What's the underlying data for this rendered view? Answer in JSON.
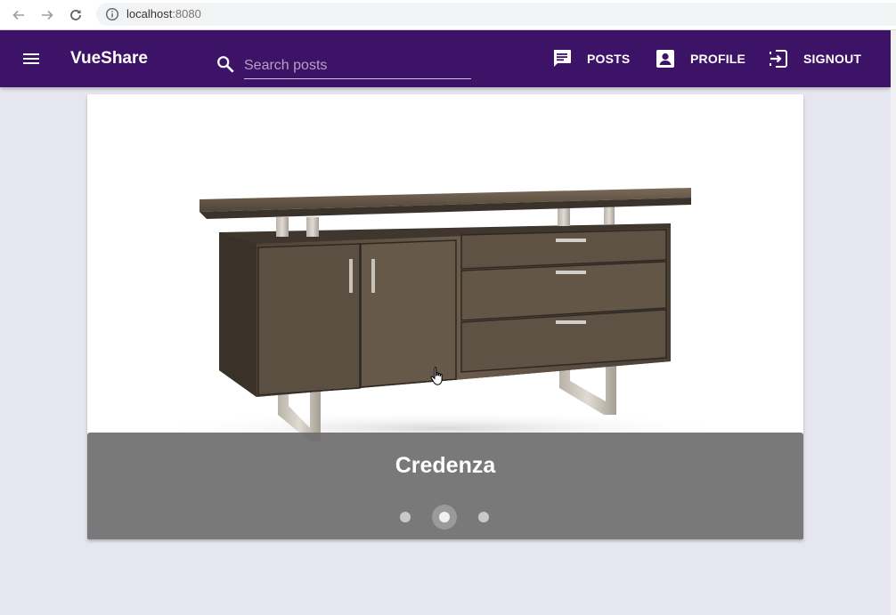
{
  "browser": {
    "url_host": "localhost",
    "url_port": ":8080"
  },
  "app": {
    "title": "VueShare"
  },
  "search": {
    "placeholder": "Search posts",
    "value": ""
  },
  "nav": {
    "posts_label": "POSTS",
    "profile_label": "PROFILE",
    "signout_label": "SIGNOUT"
  },
  "carousel": {
    "caption": "Credenza",
    "slide_count": 3,
    "active_index": 1
  },
  "colors": {
    "toolbar": "#3d1367",
    "page_background": "#e6e6f0",
    "caption_overlay": "#6e6e6e"
  }
}
